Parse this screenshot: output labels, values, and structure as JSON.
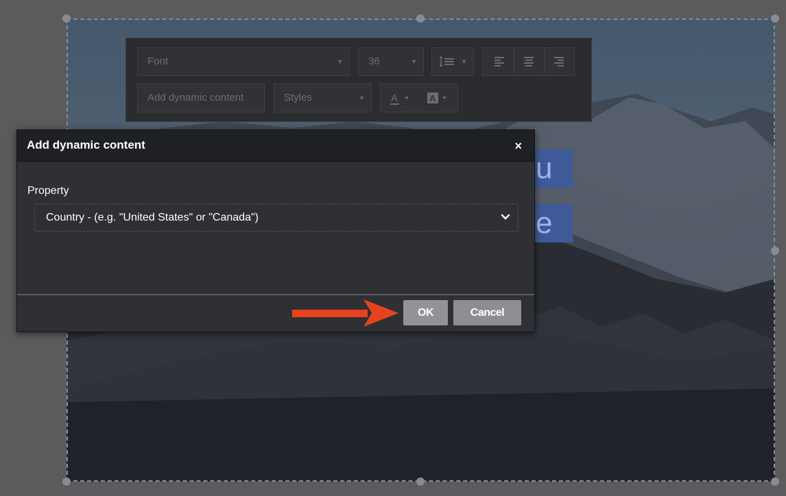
{
  "toolbar": {
    "font_label": "Font",
    "size_value": "36",
    "dynamic_content_label": "Add dynamic content",
    "styles_label": "Styles"
  },
  "selected_text": {
    "line1": "u",
    "line2": "e"
  },
  "dialog": {
    "title": "Add dynamic content",
    "close_symbol": "×",
    "property_label": "Property",
    "property_value": "Country - (e.g. \"United States\" or \"Canada\")",
    "ok_label": "OK",
    "cancel_label": "Cancel"
  },
  "colors": {
    "arrow": "#e8421c",
    "dialog_bg": "#2f3033",
    "selection_highlight": "#3e5a98"
  },
  "icons": [
    "line-height-icon",
    "align-left-icon",
    "align-center-icon",
    "align-right-icon",
    "text-color-icon",
    "highlight-color-icon",
    "chevron-down-icon",
    "close-icon",
    "arrow-pointer"
  ]
}
